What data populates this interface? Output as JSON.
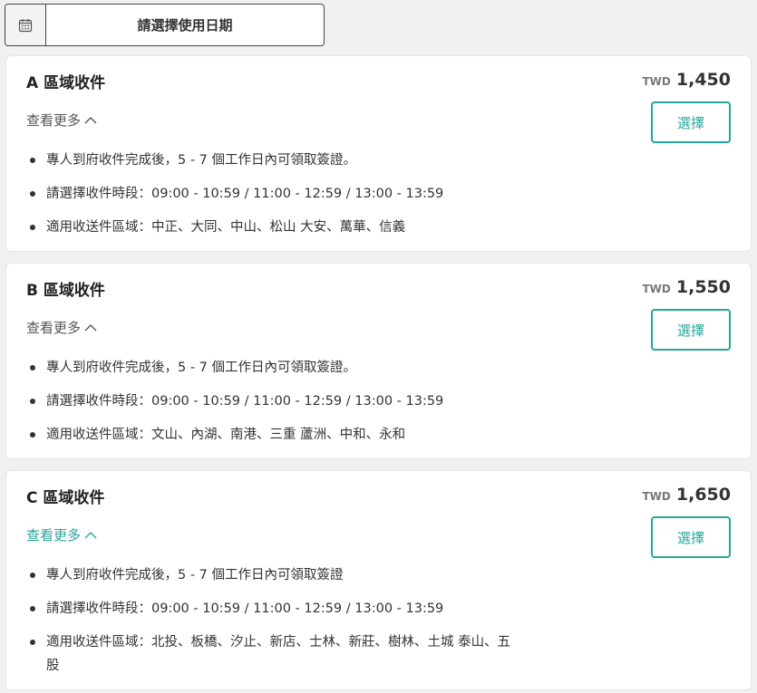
{
  "date_picker": {
    "label": "請選擇使用日期",
    "icon": "calendar-icon"
  },
  "accent_color": "#26a69a",
  "cards": [
    {
      "title": "A 區域收件",
      "see_more": "查看更多",
      "currency": "TWD",
      "price": "1,450",
      "button": "選擇",
      "bullets": [
        "專人到府收件完成後，5 - 7 個工作日內可領取簽證。",
        "請選擇收件時段：09:00 - 10:59 / 11:00 - 12:59 / 13:00 - 13:59",
        "適用收送件區域：中正、大同、中山、松山 大安、萬華、信義"
      ]
    },
    {
      "title": "B 區域收件",
      "see_more": "查看更多",
      "currency": "TWD",
      "price": "1,550",
      "button": "選擇",
      "bullets": [
        "專人到府收件完成後，5 - 7 個工作日內可領取簽證。",
        "請選擇收件時段：09:00 - 10:59 / 11:00 - 12:59 / 13:00 - 13:59",
        "適用收送件區域：文山、內湖、南港、三重 蘆洲、中和、永和"
      ]
    },
    {
      "title": "C 區域收件",
      "see_more": "查看更多",
      "currency": "TWD",
      "price": "1,650",
      "button": "選擇",
      "bullets": [
        "專人到府收件完成後，5 - 7 個工作日內可領取簽證",
        "請選擇收件時段：09:00 - 10:59 / 11:00 - 12:59 / 13:00 - 13:59",
        "適用收送件區域：北投、板橋、汐止、新店、士林、新莊、樹林、土城 泰山、五股"
      ]
    }
  ]
}
